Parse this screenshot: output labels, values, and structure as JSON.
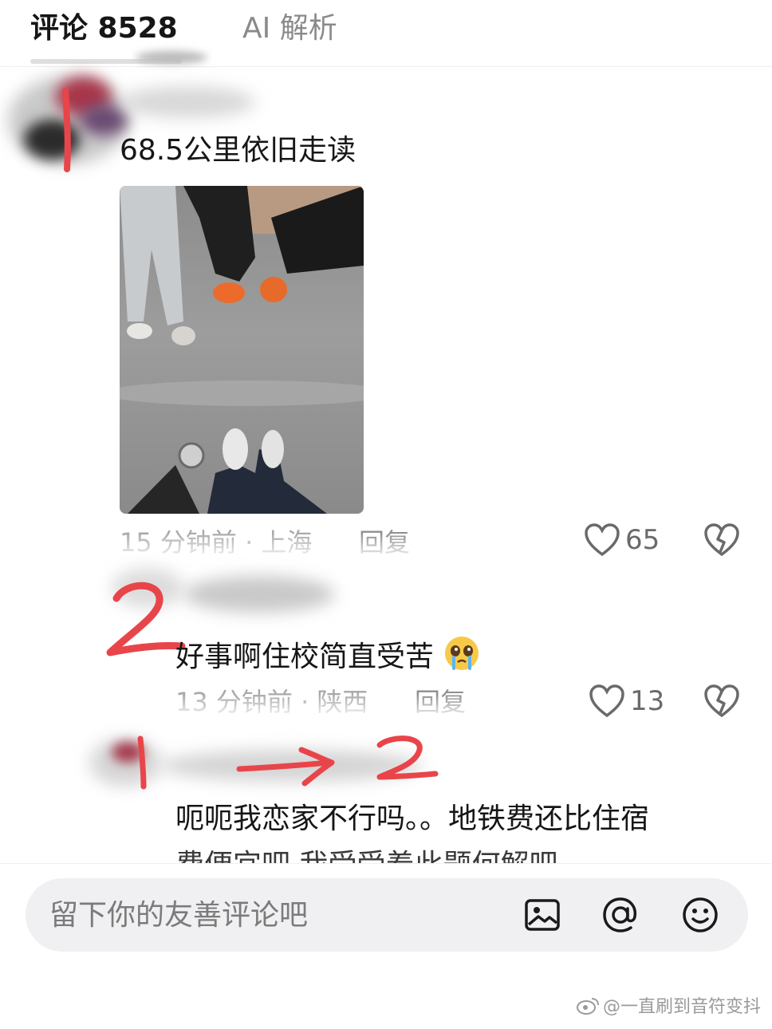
{
  "tabs": {
    "comments_label": "评论 8528",
    "ai_label": "AI 解析"
  },
  "comments": [
    {
      "text": "68.5公里依旧走读",
      "time": "15 分钟前",
      "location": "上海",
      "reply": "回复",
      "likes": "65"
    },
    {
      "text": "好事啊住校简直受苦",
      "time": "13 分钟前",
      "location": "陕西",
      "reply": "回复",
      "likes": "13"
    },
    {
      "text": "呃呃我恋家不行吗。。地铁费还比住宿",
      "text_line2": "费便宜吧 我受受着此题何解吧"
    }
  ],
  "annotations": {
    "mark1": "1",
    "mark2": "2",
    "mark3_from": "1",
    "mark3_to": "2"
  },
  "input": {
    "placeholder": "留下你的友善评论吧"
  },
  "icons": [
    "image-icon",
    "at-icon",
    "emoji-icon",
    "heart-icon",
    "broken-heart-icon"
  ],
  "watermark": "@一直刷到音符变抖",
  "colors": {
    "annotation_red": "#e8454a",
    "text": "#161616",
    "meta": "#a8a8a8"
  }
}
